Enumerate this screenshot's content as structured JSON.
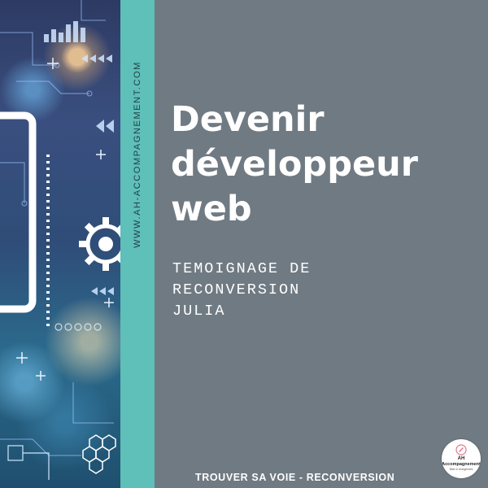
{
  "left_image": {
    "description_icons": [
      "circuit-lines",
      "bar-chart-icon",
      "chevrons",
      "gear-icon",
      "hexagon-pattern"
    ]
  },
  "sidebar": {
    "url": "WWW.AH-ACCOMPAGNEMENT.COM"
  },
  "main": {
    "title_lines": [
      "Devenir",
      "développeur",
      "web"
    ],
    "subtitle_lines": [
      "TEMOIGNAGE DE",
      "RECONVERSION",
      "JULIA"
    ]
  },
  "footer": {
    "text": "TROUVER SA VOIE - RECONVERSION"
  },
  "logo": {
    "line1": "AH",
    "line2": "Accompagnement",
    "line3": "Bilan & changement"
  },
  "colors": {
    "teal": "#5fbfb9",
    "panel_gray": "#707a82",
    "text": "#ffffff"
  }
}
